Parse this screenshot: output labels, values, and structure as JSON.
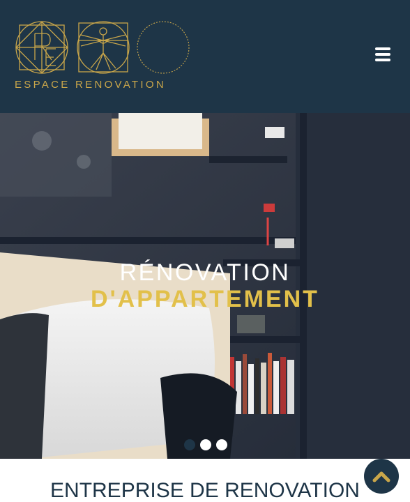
{
  "header": {
    "logo": {
      "text": "ESPACE RENOVATION",
      "monogram": "ER",
      "icon": "vitruvian-man-icon"
    },
    "menu_icon": "hamburger-menu-icon"
  },
  "hero": {
    "title": "RÉNOVATION",
    "subtitle": "D'APPARTEMENT",
    "slides": 3,
    "active_slide": 1
  },
  "section": {
    "title": "ENTREPRISE DE RENOVATION"
  },
  "scroll_top_icon": "chevron-up-icon",
  "colors": {
    "header_bg": "#1e3547",
    "gold": "#c9a64a",
    "subtitle_yellow": "#e2c04a",
    "white": "#ffffff"
  }
}
